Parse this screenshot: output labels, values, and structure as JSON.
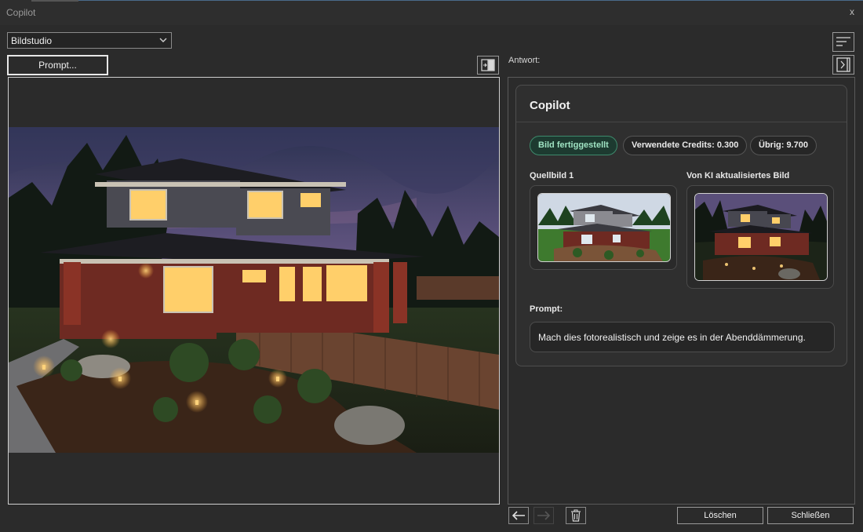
{
  "window": {
    "title": "Copilot",
    "close_label": "x"
  },
  "toolbar": {
    "mode_select": "Bildstudio",
    "prompt_button": "Prompt..."
  },
  "answer": {
    "label": "Antwort:"
  },
  "card": {
    "title": "Copilot",
    "status": "Bild fertiggestellt",
    "credits": "Verwendete Credits: 0.300",
    "remaining": "Übrig: 9.700",
    "source_label": "Quellbild 1",
    "updated_label": "Von KI aktualisiertes Bild",
    "prompt_label": "Prompt:",
    "prompt_text": "Mach dies fotorealistisch und zeige es in der Abenddämmerung."
  },
  "footer": {
    "delete_label": "Löschen",
    "close_label": "Schließen"
  },
  "icons": {
    "chevron": "chevron-down-icon",
    "swap": "swap-panels-icon",
    "sort": "sort-lines-icon",
    "panel": "collapse-panel-icon",
    "back": "arrow-left-icon",
    "forward": "arrow-right-icon",
    "trash": "trash-icon"
  },
  "colors": {
    "accent_green": "#3e8a6c",
    "background": "#2b2b2b"
  }
}
